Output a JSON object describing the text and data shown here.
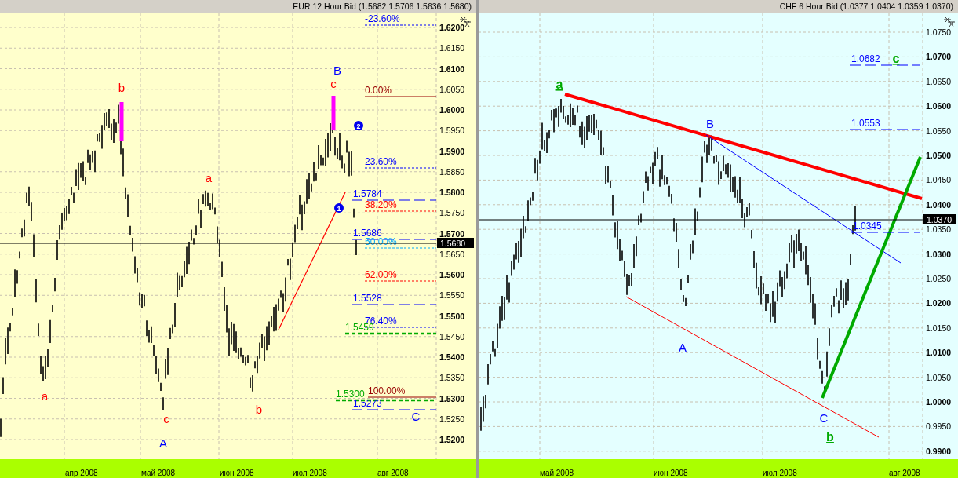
{
  "charts": [
    {
      "title": "EUR 12 Hour Bid (1.5682 1.5706 1.5636 1.5680)",
      "current_price": "1.5680",
      "ticks": [
        {
          "label": "1.6200",
          "major": true
        },
        {
          "label": "1.6150",
          "major": false
        },
        {
          "label": "1.6100",
          "major": true
        },
        {
          "label": "1.6050",
          "major": false
        },
        {
          "label": "1.6000",
          "major": true
        },
        {
          "label": "1.5950",
          "major": false
        },
        {
          "label": "1.5900",
          "major": true
        },
        {
          "label": "1.5850",
          "major": false
        },
        {
          "label": "1.5800",
          "major": true
        },
        {
          "label": "1.5750",
          "major": false
        },
        {
          "label": "1.5700",
          "major": true
        },
        {
          "label": "1.5650",
          "major": false
        },
        {
          "label": "1.5600",
          "major": true
        },
        {
          "label": "1.5550",
          "major": false
        },
        {
          "label": "1.5500",
          "major": true
        },
        {
          "label": "1.5450",
          "major": false
        },
        {
          "label": "1.5400",
          "major": true
        },
        {
          "label": "1.5350",
          "major": false
        },
        {
          "label": "1.5300",
          "major": true
        },
        {
          "label": "1.5250",
          "major": false
        },
        {
          "label": "1.5200",
          "major": true
        }
      ],
      "months": [
        "апр 2008",
        "май 2008",
        "июн 2008",
        "июл 2008",
        "авг 2008"
      ],
      "levels": [
        {
          "text": "-23.60%",
          "color": "#0000ff",
          "kind": "dashed"
        },
        {
          "text": "0.00%",
          "color": "#990000",
          "kind": "solid"
        },
        {
          "text": "23.60%",
          "color": "#0000ff",
          "kind": "dashed"
        },
        {
          "text": "1.5784",
          "color": "#0000ff",
          "kind": "longdash"
        },
        {
          "text": "38.20%",
          "color": "#ff0000",
          "kind": "dashed"
        },
        {
          "text": "1.5686",
          "color": "#0000ff",
          "kind": "longdash"
        },
        {
          "text": "50.00%",
          "color": "#00aaff",
          "kind": "dashed"
        },
        {
          "text": "62.00%",
          "color": "#ff0000",
          "kind": "dashed"
        },
        {
          "text": "1.5528",
          "color": "#0000ff",
          "kind": "longdash"
        },
        {
          "text": "76.40%",
          "color": "#0000ff",
          "kind": "dashed"
        },
        {
          "text": "1.5459",
          "color": "#00aa00",
          "kind": "thick"
        },
        {
          "text": "1.5300",
          "color": "#00aa00",
          "kind": "thick"
        },
        {
          "text": "100.00%",
          "color": "#990000",
          "kind": "solid"
        },
        {
          "text": "1.5273",
          "color": "#0000ff",
          "kind": "longdash"
        }
      ],
      "wave_labels": [
        {
          "text": "b",
          "color": "#ff0000",
          "kind": "plain"
        },
        {
          "text": "a",
          "color": "#ff0000",
          "kind": "plain"
        },
        {
          "text": "c",
          "color": "#ff0000",
          "kind": "plain"
        },
        {
          "text": "A",
          "color": "#0000ff",
          "kind": "plain"
        },
        {
          "text": "a",
          "color": "#ff0000",
          "kind": "plain"
        },
        {
          "text": "b",
          "color": "#ff0000",
          "kind": "plain"
        },
        {
          "text": "c",
          "color": "#ff0000",
          "kind": "plain"
        },
        {
          "text": "B",
          "color": "#0000ff",
          "kind": "plain"
        },
        {
          "text": "C",
          "color": "#0000ff",
          "kind": "plain"
        }
      ],
      "markers": [
        "1",
        "2"
      ]
    },
    {
      "title": "CHF 6 Hour Bid (1.0377 1.0404 1.0359 1.0370)",
      "current_price": "1.0370",
      "ticks": [
        {
          "label": "1.0750",
          "major": false
        },
        {
          "label": "1.0700",
          "major": true
        },
        {
          "label": "1.0650",
          "major": false
        },
        {
          "label": "1.0600",
          "major": true
        },
        {
          "label": "1.0550",
          "major": false
        },
        {
          "label": "1.0500",
          "major": true
        },
        {
          "label": "1.0450",
          "major": false
        },
        {
          "label": "1.0400",
          "major": true
        },
        {
          "label": "1.0350",
          "major": false
        },
        {
          "label": "1.0300",
          "major": true
        },
        {
          "label": "1.0250",
          "major": false
        },
        {
          "label": "1.0200",
          "major": true
        },
        {
          "label": "1.0150",
          "major": false
        },
        {
          "label": "1.0100",
          "major": true
        },
        {
          "label": "1.0050",
          "major": false
        },
        {
          "label": "1.0000",
          "major": true
        },
        {
          "label": "0.9950",
          "major": false
        },
        {
          "label": "0.9900",
          "major": true
        }
      ],
      "months": [
        "май 2008",
        "июн 2008",
        "июл 2008",
        "авг 2008"
      ],
      "levels": [
        {
          "text": "1.0682",
          "color": "#0000ff",
          "kind": "longdash"
        },
        {
          "text": "1.0553",
          "color": "#0000ff",
          "kind": "longdash"
        },
        {
          "text": "1.0345",
          "color": "#0000ff",
          "kind": "longdash"
        }
      ],
      "wave_labels": [
        {
          "text": "a",
          "color": "#00aa00",
          "kind": "underlined"
        },
        {
          "text": "B",
          "color": "#0000ff",
          "kind": "plain"
        },
        {
          "text": "A",
          "color": "#0000ff",
          "kind": "plain"
        },
        {
          "text": "C",
          "color": "#0000ff",
          "kind": "plain"
        },
        {
          "text": "b",
          "color": "#00aa00",
          "kind": "underlined"
        },
        {
          "text": "c",
          "color": "#00aa00",
          "kind": "underlined"
        }
      ]
    }
  ]
}
